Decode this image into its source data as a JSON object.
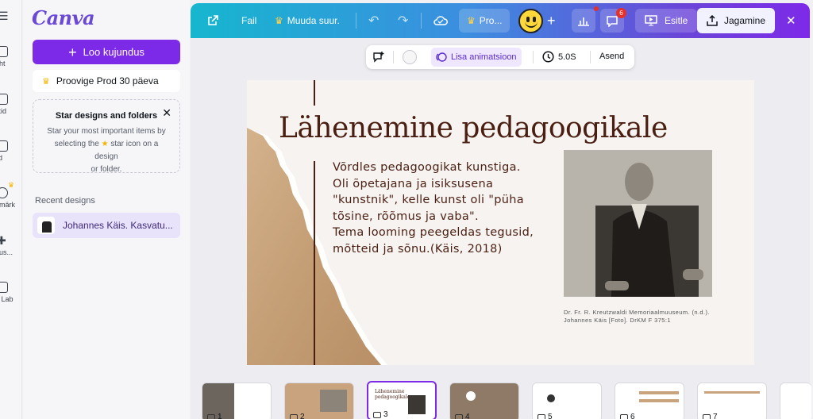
{
  "rail": {
    "items": [
      {
        "label": "eht",
        "icon": "home-icon"
      },
      {
        "label": "ktid",
        "icon": "folder-icon"
      },
      {
        "label": "lid",
        "icon": "template-icon"
      },
      {
        "label": "ämärk",
        "icon": "brand-icon"
      },
      {
        "label": "dus...",
        "icon": "apps-icon"
      },
      {
        "label": "n Lab",
        "icon": "lab-icon"
      }
    ]
  },
  "sidebar": {
    "logo": "Canva",
    "create_label": "Loo kujundus",
    "trial_label": "Proovige Prod 30 päeva",
    "star_card": {
      "title": "Star designs and folders",
      "text_1": "Star your most important items by",
      "text_2": "selecting the",
      "text_3": "star icon on a design",
      "text_4": "or folder."
    },
    "recent_heading": "Recent designs",
    "recent_items": [
      "Johannes Käis. Kasvatu..."
    ]
  },
  "topbar": {
    "file_label": "Fail",
    "resize_label": "Muuda suur.",
    "pro_label": "Pro...",
    "notification_count": "6",
    "present_label": "Esitle",
    "share_label": "Jagamine"
  },
  "context_bar": {
    "animate_label": "Lisa animatsioon",
    "duration": "5.0S",
    "position_label": "Asend"
  },
  "slide": {
    "title": "Lähenemine pedagoogikale",
    "body": [
      "Võrdles pedagoogikat kunstiga.",
      "Oli õpetajana ja isiksusena",
      "\"kunstnik\", kelle kunst oli \"püha",
      "tõsine, rõõmus ja vaba\".",
      "Tema looming peegeldas tegusid,",
      "mõtteid ja sõnu.(Käis, 2018)"
    ],
    "caption_1": "Dr. Fr. R. Kreutzwaldi Memoriaalmuuseum. (n.d.).",
    "caption_2": "Johannes Käis [Foto]. DrKM F 375:1"
  },
  "filmstrip": {
    "pages": [
      "1",
      "2",
      "3",
      "4",
      "5",
      "6",
      "7"
    ],
    "selected": "3"
  },
  "colors": {
    "brand_purple": "#7d2ae8",
    "title_brown": "#4a1f12",
    "paper_tan": "#c9a37b"
  }
}
